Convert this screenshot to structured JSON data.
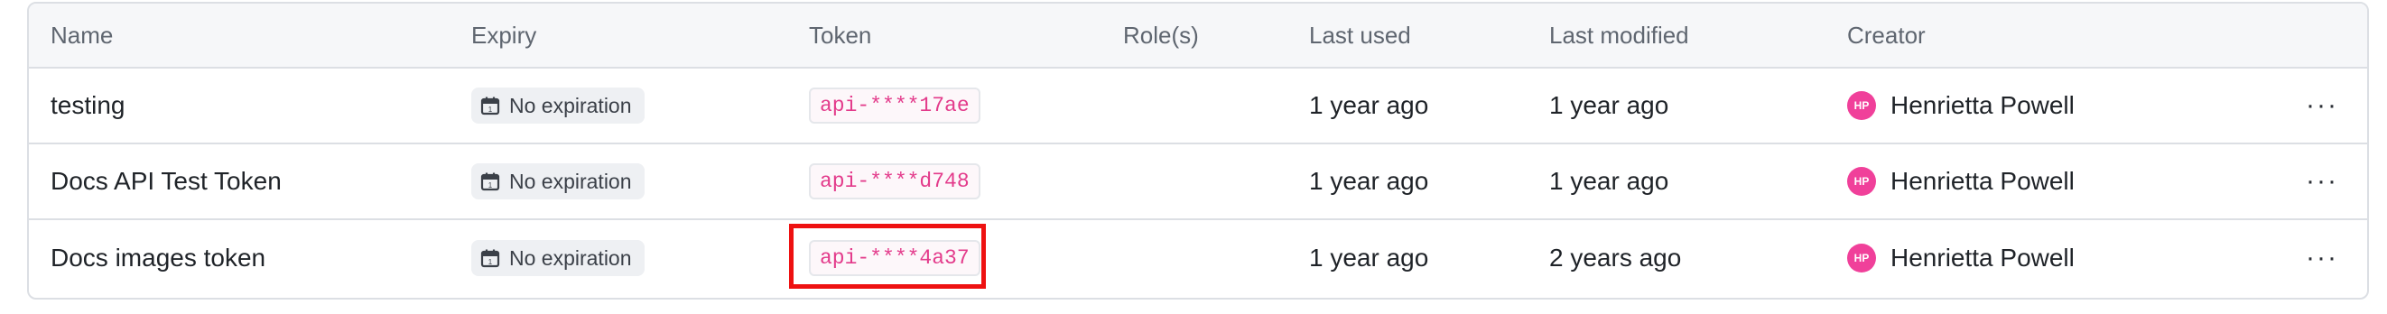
{
  "columns": {
    "name": "Name",
    "expiry": "Expiry",
    "token": "Token",
    "roles": "Role(s)",
    "last_used": "Last used",
    "last_modified": "Last modified",
    "creator": "Creator"
  },
  "rows": [
    {
      "name": "testing",
      "expiry": "No expiration",
      "token": "api-****17ae",
      "roles": "",
      "last_used": "1 year ago",
      "last_modified": "1 year ago",
      "creator_initials": "HP",
      "creator": "Henrietta Powell",
      "more": "···"
    },
    {
      "name": "Docs API Test Token",
      "expiry": "No expiration",
      "token": "api-****d748",
      "roles": "",
      "last_used": "1 year ago",
      "last_modified": "1 year ago",
      "creator_initials": "HP",
      "creator": "Henrietta Powell",
      "more": "···"
    },
    {
      "name": "Docs images token",
      "expiry": "No expiration",
      "token": "api-****4a37",
      "roles": "",
      "last_used": "1 year ago",
      "last_modified": "2 years ago",
      "creator_initials": "HP",
      "creator": "Henrietta Powell",
      "more": "···"
    }
  ],
  "icons": {
    "expiry": "calendar-icon",
    "more": "more-horizontal-icon"
  },
  "colors": {
    "token_text": "#e33b8b",
    "avatar": "#f0409a",
    "highlight": "#ee1111",
    "border": "#dcdfe4"
  },
  "highlighted_row": 2
}
